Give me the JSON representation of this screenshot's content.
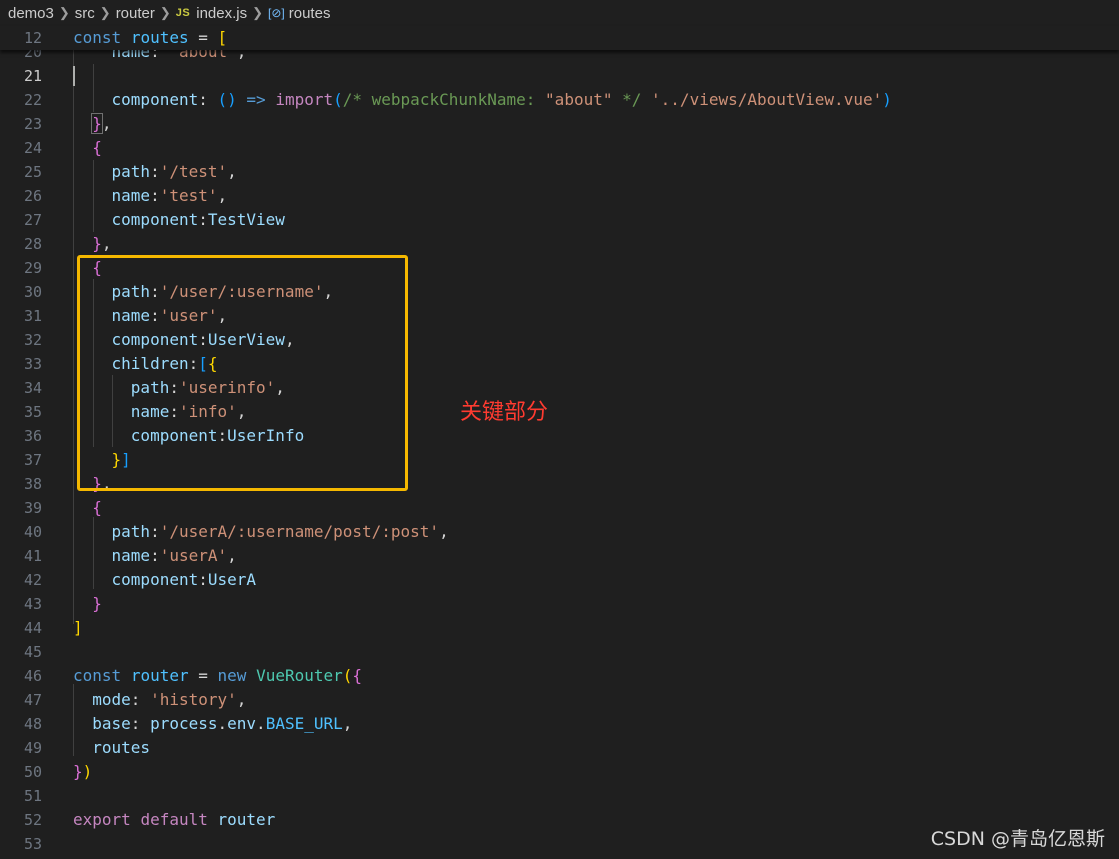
{
  "breadcrumb": {
    "items": [
      "demo3",
      "src",
      "router",
      "index.js",
      "routes"
    ],
    "file_type_badge": "JS",
    "separator_icon": "chevron-right-icon",
    "symbol_icon": "symbol-variable-icon"
  },
  "editor": {
    "language": "javascript",
    "active_line": 21,
    "sticky_line": {
      "number": "12",
      "text": "const routes = ["
    },
    "partial_line": {
      "number": "20",
      "text": "    name: 'about',"
    },
    "lines": [
      {
        "number": "21",
        "text": ""
      },
      {
        "number": "22",
        "text": "    component: () => import(/* webpackChunkName: \"about\" */ '../views/AboutView.vue')"
      },
      {
        "number": "23",
        "text": "  },"
      },
      {
        "number": "24",
        "text": "  {"
      },
      {
        "number": "25",
        "text": "    path:'/test',"
      },
      {
        "number": "26",
        "text": "    name:'test',"
      },
      {
        "number": "27",
        "text": "    component:TestView"
      },
      {
        "number": "28",
        "text": "  },"
      },
      {
        "number": "29",
        "text": "  {"
      },
      {
        "number": "30",
        "text": "    path:'/user/:username',"
      },
      {
        "number": "31",
        "text": "    name:'user',"
      },
      {
        "number": "32",
        "text": "    component:UserView,"
      },
      {
        "number": "33",
        "text": "    children:[{"
      },
      {
        "number": "34",
        "text": "      path:'userinfo',"
      },
      {
        "number": "35",
        "text": "      name:'info',"
      },
      {
        "number": "36",
        "text": "      component:UserInfo"
      },
      {
        "number": "37",
        "text": "    }]"
      },
      {
        "number": "38",
        "text": "  },"
      },
      {
        "number": "39",
        "text": "  {"
      },
      {
        "number": "40",
        "text": "    path:'/userA/:username/post/:post',"
      },
      {
        "number": "41",
        "text": "    name:'userA',"
      },
      {
        "number": "42",
        "text": "    component:UserA"
      },
      {
        "number": "43",
        "text": "  }"
      },
      {
        "number": "44",
        "text": "]"
      },
      {
        "number": "45",
        "text": ""
      },
      {
        "number": "46",
        "text": "const router = new VueRouter({"
      },
      {
        "number": "47",
        "text": "  mode: 'history',"
      },
      {
        "number": "48",
        "text": "  base: process.env.BASE_URL,"
      },
      {
        "number": "49",
        "text": "  routes"
      },
      {
        "number": "50",
        "text": "})"
      },
      {
        "number": "51",
        "text": ""
      },
      {
        "number": "52",
        "text": "export default router"
      },
      {
        "number": "53",
        "text": ""
      }
    ]
  },
  "annotation": {
    "label": "关键部分",
    "box_color": "#f5b800",
    "label_color": "#ff3b30"
  },
  "watermark": "CSDN @青岛亿恩斯",
  "colors": {
    "background": "#1f1f1f",
    "keyword": "#569cd6",
    "string": "#ce9178",
    "property": "#9cdcfe",
    "function": "#dcdcaa",
    "class": "#4ec9b0",
    "comment": "#6a9955",
    "bracket_level1": "#ffd700",
    "bracket_level2": "#da70d6",
    "bracket_level3": "#179fff"
  }
}
